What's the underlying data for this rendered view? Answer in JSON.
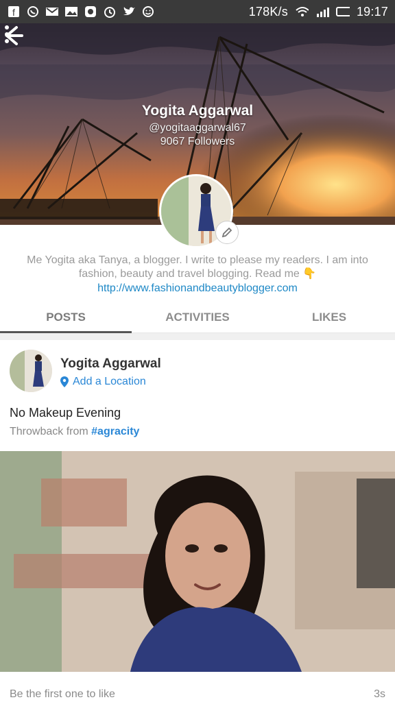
{
  "status_bar": {
    "network_speed": "178K/s",
    "time": "19:17",
    "icons": [
      "facebook-icon",
      "whatsapp-icon",
      "gmail-icon",
      "image-icon",
      "instagram-icon",
      "alarm-icon",
      "twitter-icon",
      "smiley-icon",
      "wifi-icon",
      "signal-icon",
      "battery-icon"
    ]
  },
  "profile": {
    "name": "Yogita Aggarwal",
    "handle": "@yogitaaggarwal67",
    "followers": "9067 Followers",
    "bio": "Me Yogita aka Tanya, a blogger. I write to please my readers. I am into fashion, beauty and travel blogging. Read me 👇",
    "website": "http://www.fashionandbeautyblogger.com"
  },
  "tabs": [
    "POSTS",
    "ACTIVITIES",
    "LIKES"
  ],
  "post": {
    "author": "Yogita Aggarwal",
    "location_prompt": "Add a Location",
    "title": "No Makeup Evening",
    "throwback_prefix": "Throwback from",
    "throwback_tag": "#agracity",
    "likes_prompt": "Be the first one to like",
    "time_ago": "3s"
  },
  "colors": {
    "link": "#2a87d6",
    "status_bar": "#3a3a3a"
  }
}
